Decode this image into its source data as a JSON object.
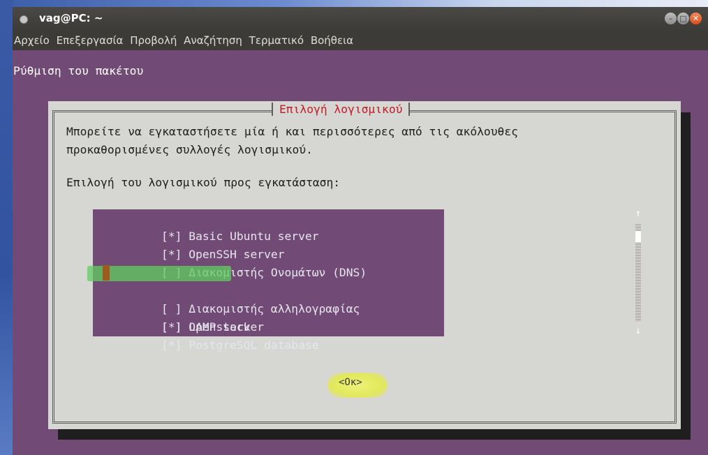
{
  "window": {
    "title": "vag@PC: ~"
  },
  "menu": {
    "items": [
      "Αρχείο",
      "Επεξεργασία",
      "Προβολή",
      "Αναζήτηση",
      "Τερματικό",
      "Βοήθεια"
    ]
  },
  "terminal": {
    "header": "Ρύθμιση του πακέτου"
  },
  "dialog": {
    "title": "Επιλογή λογισμικού",
    "description_line1": "Μπορείτε να εγκαταστήσετε μία ή και περισσότερες από τις ακόλουθες",
    "description_line2": "προκαθορισμένες συλλογές λογισμικού.",
    "prompt": "Επιλογή του λογισμικού προς εγκατάσταση:",
    "items": [
      {
        "check": "[*]",
        "label": "Basic Ubuntu server",
        "selected": true
      },
      {
        "check": "[*]",
        "label": "OpenSSH server",
        "selected": true
      },
      {
        "check": "[ ]",
        "label": "Διακομιστής Ονομάτων (DNS)",
        "selected": false
      },
      {
        "check": "[*]",
        "label": "LAMP server",
        "selected": true,
        "focused": true
      },
      {
        "check": "[ ]",
        "label": "Διακομιστής αλληλογραφίας",
        "selected": false
      },
      {
        "check": "[ ]",
        "label": "Openstack",
        "selected": false
      },
      {
        "check": "[*]",
        "label": "PostgreSQL database",
        "selected": true
      }
    ],
    "scroll_up_glyph": "↑",
    "scroll_down_glyph": "↓",
    "ok_label": "<Οκ>"
  },
  "colors": {
    "terminal_bg": "#714b75",
    "dialog_bg": "#d6d6d2",
    "title_red": "#c01c28",
    "highlight_green": "#5fcd5f",
    "highlight_yellow": "#e2e85a"
  },
  "icons": {
    "window_menu": "terminal-dot-icon",
    "minimize": "minimize-icon",
    "maximize": "maximize-icon",
    "close": "close-icon"
  }
}
